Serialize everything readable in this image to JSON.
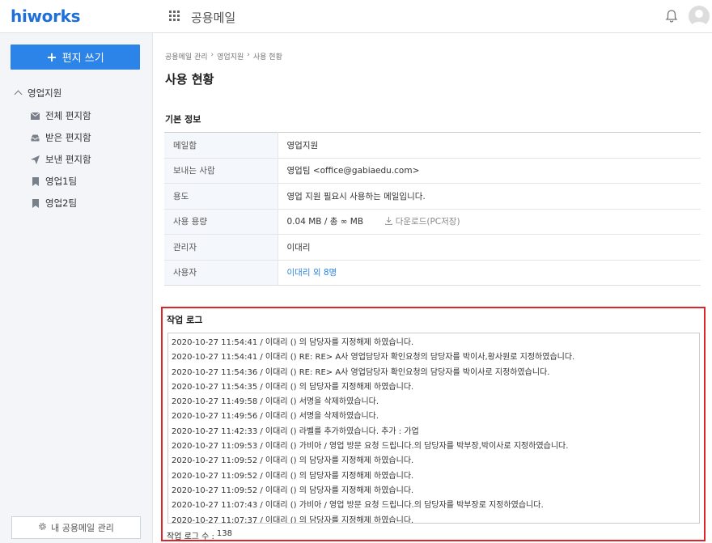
{
  "header": {
    "logo": "hiworks",
    "app_title": "공용메일"
  },
  "sidebar": {
    "compose_label": "편지 쓰기",
    "group_label": "영업지원",
    "items": [
      {
        "label": "전체 편지함",
        "icon": "mail-icon"
      },
      {
        "label": "받은 편지함",
        "icon": "inbox-icon"
      },
      {
        "label": "보낸 편지함",
        "icon": "send-icon"
      },
      {
        "label": "영업1팀",
        "icon": "bookmark-icon"
      },
      {
        "label": "영업2팀",
        "icon": "bookmark-icon"
      }
    ],
    "manage_label": "내 공용메일 관리"
  },
  "main": {
    "breadcrumb": [
      "공용메일 관리",
      "영업지원",
      "사용 현황"
    ],
    "page_title": "사용 현황",
    "basic_info_title": "기본 정보",
    "info": [
      {
        "label": "메일함",
        "value": "영업지원"
      },
      {
        "label": "보내는 사람",
        "value": "영업팀 <office@gabiaedu.com>"
      },
      {
        "label": "용도",
        "value": "영업 지원 필요시 사용하는 메일입니다."
      },
      {
        "label": "사용 용량",
        "value": "0.04 MB / 총 ∞ MB",
        "extra": "다운로드(PC저장)"
      },
      {
        "label": "관리자",
        "value": "이대리"
      },
      {
        "label": "사용자",
        "value": "이대리 외 8명"
      }
    ],
    "log_title": "작업 로그",
    "logs": [
      "2020-10-27 11:54:41 / 이대리 () 의 담당자를 지정해제 하였습니다.",
      "2020-10-27 11:54:41 / 이대리 () RE: RE> A사 영업담당자 확인요청의 담당자를 박이사,황사원로 지정하였습니다.",
      "2020-10-27 11:54:36 / 이대리 () RE: RE> A사 영업담당자 확인요청의 담당자를 박이사로 지정하였습니다.",
      "2020-10-27 11:54:35 / 이대리 () 의 담당자를 지정해제 하였습니다.",
      "2020-10-27 11:49:58 / 이대리 () 서명을 삭제하였습니다.",
      "2020-10-27 11:49:56 / 이대리 () 서명을 삭제하였습니다.",
      "2020-10-27 11:42:33 / 이대리 () 라벨를 추가하였습니다. 추가 : 가업",
      "2020-10-27 11:09:53 / 이대리 () 가비아 / 영업 방문 요청 드립니다.의 담당자를 박부장,박이사로 지정하였습니다.",
      "2020-10-27 11:09:52 / 이대리 () 의 담당자를 지정해제 하였습니다.",
      "2020-10-27 11:09:52 / 이대리 () 의 담당자를 지정해제 하였습니다.",
      "2020-10-27 11:09:52 / 이대리 () 의 담당자를 지정해제 하였습니다.",
      "2020-10-27 11:07:43 / 이대리 () 가비아 / 영업 방문 요청 드립니다.의 담당자를 박부장로 지정하였습니다.",
      "2020-10-27 11:07:37 / 이대리 () 의 담당자를 지정해제 하였습니다."
    ],
    "log_count_label": "작업 로그 수 :",
    "log_count": "138"
  },
  "colors": {
    "brand": "#1e6fd9",
    "compose": "#2d84e8",
    "highlight_border": "#d9262b"
  }
}
